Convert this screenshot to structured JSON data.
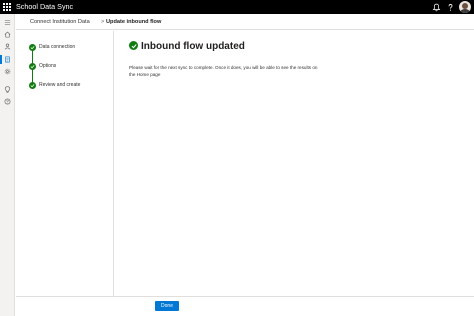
{
  "app": {
    "title": "School Data Sync",
    "icons": [
      "waffle-icon",
      "bell-icon",
      "help-icon",
      "avatar"
    ]
  },
  "leftnav": {
    "items": [
      {
        "name": "hamburger-icon"
      },
      {
        "name": "home-icon"
      },
      {
        "name": "people-icon"
      },
      {
        "name": "document-icon",
        "active": true
      },
      {
        "name": "settings-icon"
      },
      {
        "name": "lightbulb-icon"
      },
      {
        "name": "help-circle-icon"
      }
    ]
  },
  "breadcrumb": {
    "parent": "Connect Institution Data",
    "separator": ">",
    "current": "Update inbound flow"
  },
  "steps": [
    {
      "label": "Data connection",
      "status": "complete"
    },
    {
      "label": "Options",
      "status": "complete"
    },
    {
      "label": "Review and create",
      "status": "complete"
    }
  ],
  "main": {
    "heading": "Inbound flow updated",
    "message": "Please wait for the next sync to complete. Once it does, you will be able to see the results on the Home page"
  },
  "footer": {
    "done_label": "Done"
  },
  "colors": {
    "topbar": "#000000",
    "accent": "#0078d4",
    "success": "#107c10"
  }
}
